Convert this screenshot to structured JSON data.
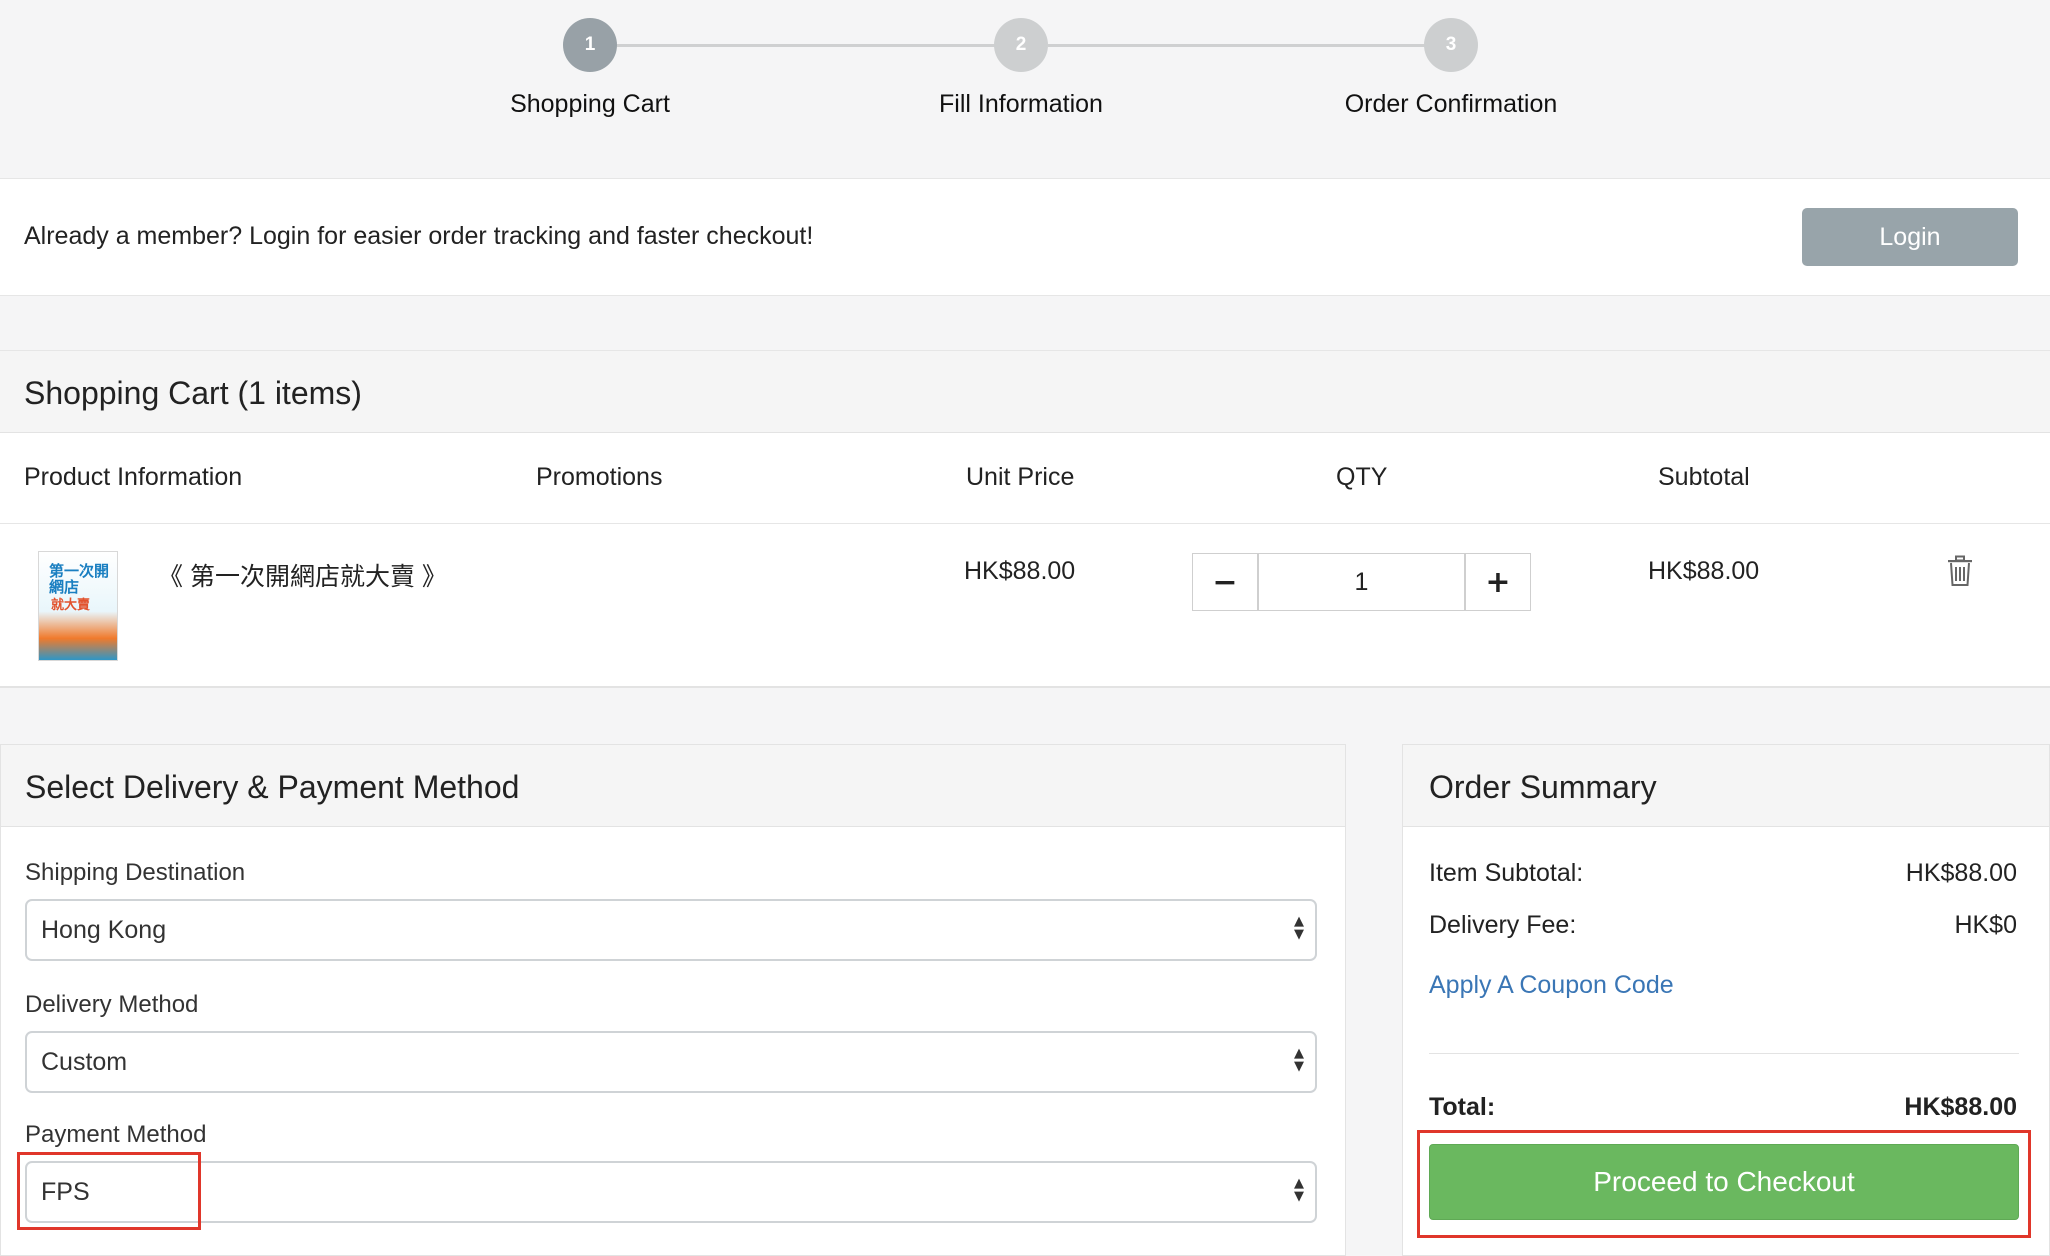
{
  "stepper": {
    "steps": [
      {
        "number": "1",
        "label": "Shopping Cart"
      },
      {
        "number": "2",
        "label": "Fill Information"
      },
      {
        "number": "3",
        "label": "Order Confirmation"
      }
    ]
  },
  "member_bar": {
    "text": "Already a member? Login for easier order tracking and faster checkout!",
    "login_label": "Login"
  },
  "cart": {
    "title": "Shopping Cart  (1 items)",
    "columns": [
      "Product Information",
      "Promotions",
      "Unit Price",
      "QTY",
      "Subtotal"
    ],
    "item": {
      "name": "《 第一次開網店就大賣 》",
      "cover_title": "第一次開網店",
      "cover_subtitle": "就大賣",
      "unit_price": "HK$88.00",
      "qty": "1",
      "subtotal": "HK$88.00",
      "minus_icon": "minus-icon",
      "plus_icon": "plus-icon",
      "delete_icon": "trash-icon"
    }
  },
  "delivery": {
    "title": "Select Delivery & Payment Method",
    "shipping_label": "Shipping Destination",
    "shipping_value": "Hong Kong",
    "method_label": "Delivery Method",
    "method_value": "Custom",
    "payment_label": "Payment Method",
    "payment_value": "FPS"
  },
  "summary": {
    "title": "Order Summary",
    "item_subtotal_label": "Item Subtotal:",
    "item_subtotal_value": "HK$88.00",
    "delivery_fee_label": "Delivery Fee:",
    "delivery_fee_value": "HK$0",
    "coupon_label": "Apply A Coupon Code",
    "total_label": "Total:",
    "total_value": "HK$88.00",
    "checkout_label": "Proceed to Checkout"
  },
  "colors": {
    "checkout": "#6ab85f",
    "login": "#98a4aa",
    "link": "#3a76b5",
    "highlight": "#e0362a"
  }
}
